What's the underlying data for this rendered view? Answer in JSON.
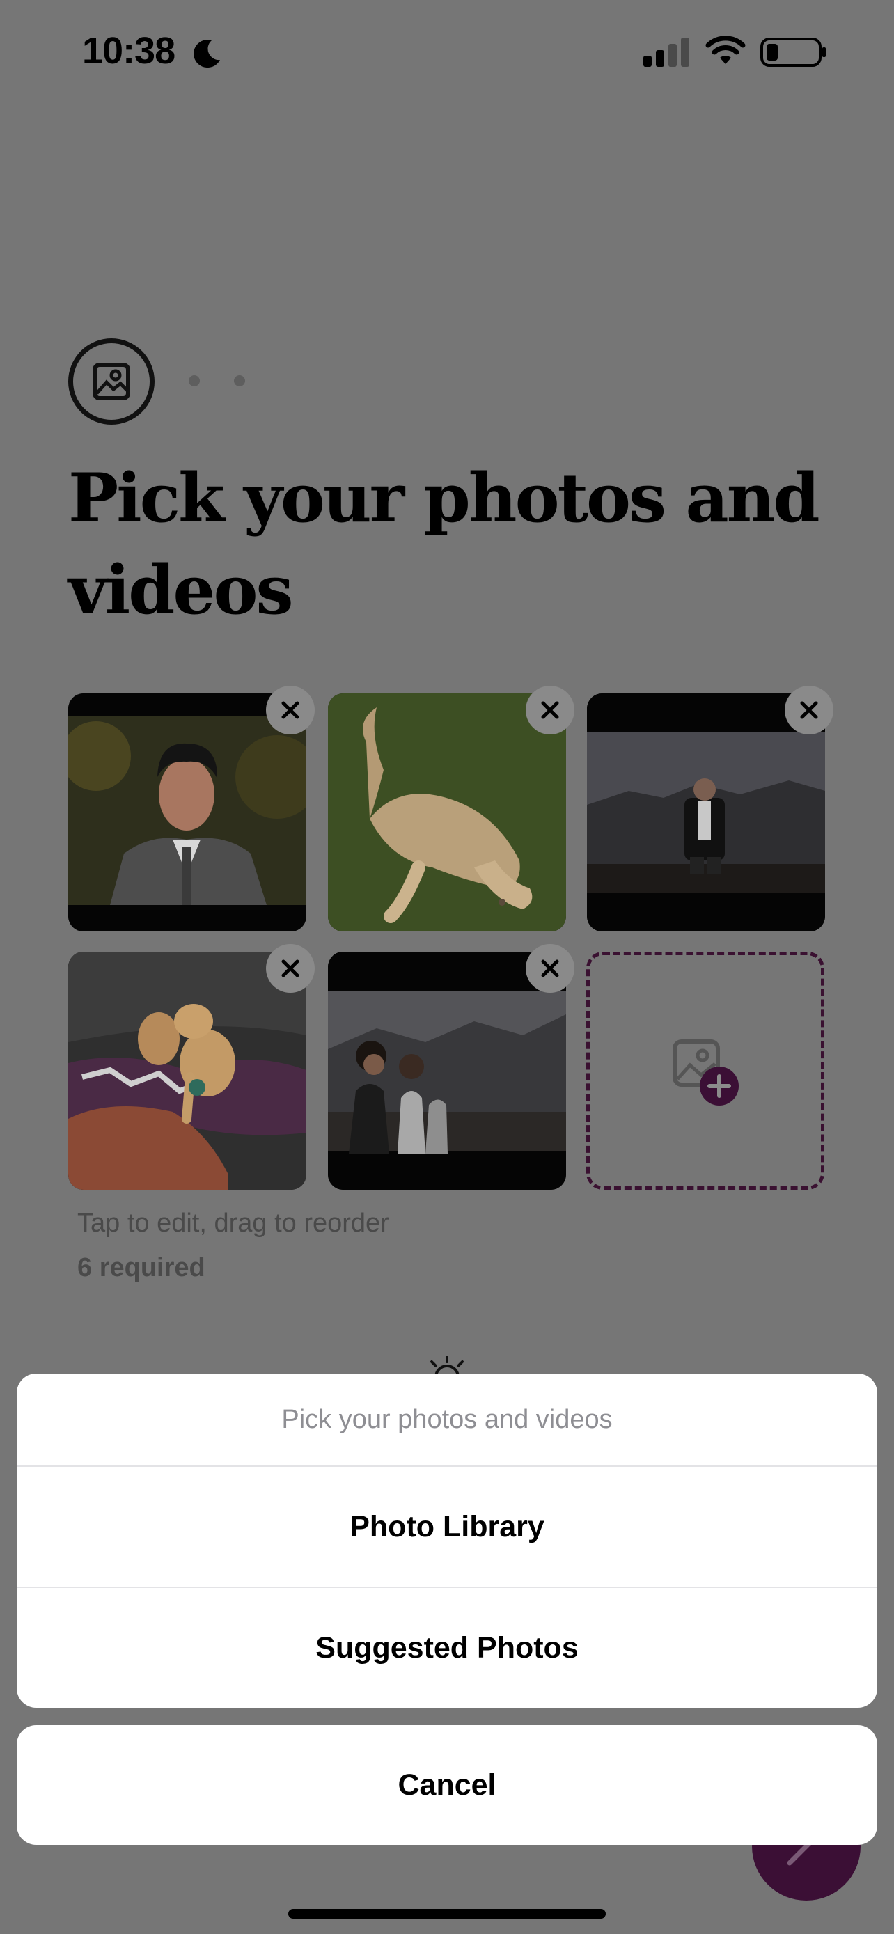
{
  "status_bar": {
    "time": "10:38",
    "icons": [
      "moon-icon",
      "cellular-signal-icon",
      "wifi-icon",
      "battery-icon"
    ]
  },
  "onboarding": {
    "step_icon": "image-icon",
    "title": "Pick your photos and videos",
    "photos": [
      {
        "name": "photo-portrait-suit",
        "icon": "close-icon"
      },
      {
        "name": "photo-dog-on-grass",
        "icon": "close-icon"
      },
      {
        "name": "photo-man-mountains",
        "icon": "close-icon"
      },
      {
        "name": "photo-puppies-on-couch",
        "icon": "close-icon"
      },
      {
        "name": "photo-friends-desert",
        "icon": "close-icon"
      }
    ],
    "add_slot_icon": "add-photo-icon",
    "hint": "Tap to edit, drag to reorder",
    "required": "6 required"
  },
  "action_sheet": {
    "title": "Pick your photos and videos",
    "options": [
      "Photo Library",
      "Suggested Photos"
    ],
    "cancel": "Cancel"
  },
  "colors": {
    "accent": "#3b0f35",
    "dim_background": "#767676",
    "sheet_background": "#ffffff",
    "sheet_title": "#8e8e93"
  }
}
